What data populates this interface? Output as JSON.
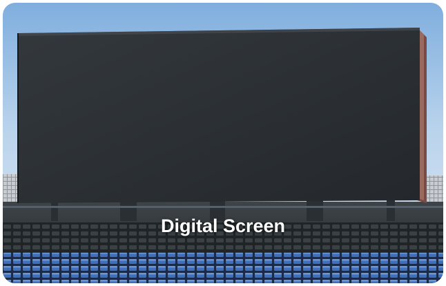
{
  "card": {
    "title": "Digital Screen"
  }
}
